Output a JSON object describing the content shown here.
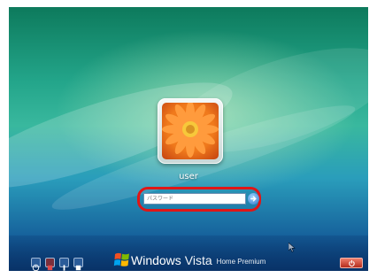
{
  "user": {
    "name": "user",
    "avatar": "orange-flower-picture"
  },
  "password": {
    "placeholder": "パスワード",
    "value": ""
  },
  "taskbar": {
    "accessibility_buttons": [
      "ease-of-access-icon",
      "language-icon",
      "keyboard-icon",
      "display-icon"
    ],
    "brand_windows": "Windows",
    "brand_vista": "Vista",
    "brand_edition": "Home Premium",
    "shutdown_icon": "power-icon"
  },
  "colors": {
    "highlight": "#e01616",
    "shutdown": "#c43a28"
  }
}
